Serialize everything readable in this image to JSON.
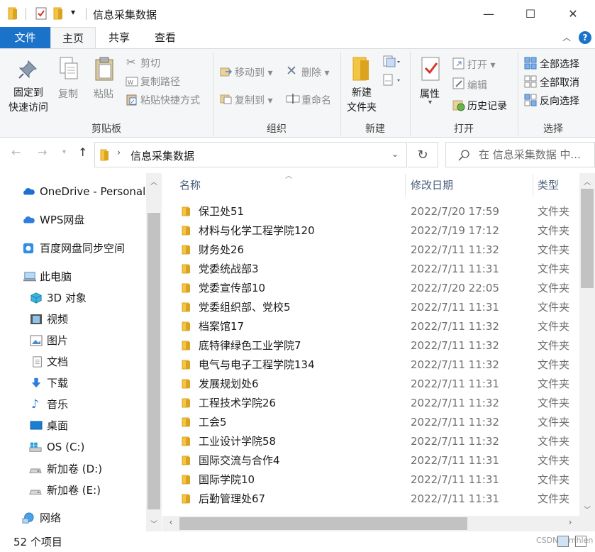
{
  "window": {
    "title": "信息采集数据",
    "quick_access_dropdown": "▾",
    "minimize": "—",
    "maximize": "☐",
    "close": "✕"
  },
  "tabs": [
    {
      "label": "文件"
    },
    {
      "label": "主页"
    },
    {
      "label": "共享"
    },
    {
      "label": "查看"
    }
  ],
  "ribbon": {
    "clipboard": {
      "pin_label_1": "固定到",
      "pin_label_2": "快速访问",
      "copy": "复制",
      "paste": "粘贴",
      "cut": "剪切",
      "copy_path": "复制路径",
      "paste_shortcut": "粘贴快捷方式",
      "group": "剪贴板"
    },
    "organize": {
      "move_to": "移动到",
      "copy_to": "复制到",
      "delete": "删除",
      "rename": "重命名",
      "group": "组织"
    },
    "new": {
      "new_folder_1": "新建",
      "new_folder_2": "文件夹",
      "group": "新建"
    },
    "open": {
      "properties": "属性",
      "open": "打开",
      "edit": "编辑",
      "history": "历史记录",
      "group": "打开"
    },
    "select": {
      "select_all": "全部选择",
      "select_none": "全部取消",
      "invert": "反向选择",
      "group": "选择"
    }
  },
  "address": {
    "path": "信息采集数据",
    "search_placeholder": "在 信息采集数据 中..."
  },
  "nav": [
    {
      "label": "OneDrive - Personal",
      "icon": "cloud-icon"
    },
    {
      "label": "WPS网盘",
      "icon": "cloud-icon"
    },
    {
      "label": "百度网盘同步空间",
      "icon": "baidu-icon"
    },
    {
      "label": "此电脑",
      "icon": "computer-icon"
    },
    {
      "label": "3D 对象",
      "icon": "cube-icon"
    },
    {
      "label": "视频",
      "icon": "film-icon"
    },
    {
      "label": "图片",
      "icon": "picture-icon"
    },
    {
      "label": "文档",
      "icon": "document-icon"
    },
    {
      "label": "下载",
      "icon": "download-icon"
    },
    {
      "label": "音乐",
      "icon": "music-icon"
    },
    {
      "label": "桌面",
      "icon": "desktop-icon"
    },
    {
      "label": "OS (C:)",
      "icon": "windows-drive-icon"
    },
    {
      "label": "新加卷 (D:)",
      "icon": "drive-icon"
    },
    {
      "label": "新加卷 (E:)",
      "icon": "drive-icon"
    },
    {
      "label": "网络",
      "icon": "network-icon"
    }
  ],
  "columns": {
    "name": "名称",
    "date": "修改日期",
    "type": "类型"
  },
  "files": [
    {
      "name": "保卫处51",
      "date": "2022/7/20 17:59",
      "type": "文件夹"
    },
    {
      "name": "材料与化学工程学院120",
      "date": "2022/7/19 17:12",
      "type": "文件夹"
    },
    {
      "name": "财务处26",
      "date": "2022/7/11 11:32",
      "type": "文件夹"
    },
    {
      "name": "党委统战部3",
      "date": "2022/7/11 11:31",
      "type": "文件夹"
    },
    {
      "name": "党委宣传部10",
      "date": "2022/7/20 22:05",
      "type": "文件夹"
    },
    {
      "name": "党委组织部、党校5",
      "date": "2022/7/11 11:31",
      "type": "文件夹"
    },
    {
      "name": "档案馆17",
      "date": "2022/7/11 11:32",
      "type": "文件夹"
    },
    {
      "name": "底特律绿色工业学院7",
      "date": "2022/7/11 11:32",
      "type": "文件夹"
    },
    {
      "name": "电气与电子工程学院134",
      "date": "2022/7/11 11:32",
      "type": "文件夹"
    },
    {
      "name": "发展规划处6",
      "date": "2022/7/11 11:31",
      "type": "文件夹"
    },
    {
      "name": "工程技术学院26",
      "date": "2022/7/11 11:32",
      "type": "文件夹"
    },
    {
      "name": "工会5",
      "date": "2022/7/11 11:32",
      "type": "文件夹"
    },
    {
      "name": "工业设计学院58",
      "date": "2022/7/11 11:32",
      "type": "文件夹"
    },
    {
      "name": "国际交流与合作4",
      "date": "2022/7/11 11:31",
      "type": "文件夹"
    },
    {
      "name": "国际学院10",
      "date": "2022/7/11 11:31",
      "type": "文件夹"
    },
    {
      "name": "后勤管理处67",
      "date": "2022/7/11 11:31",
      "type": "文件夹"
    }
  ],
  "status": {
    "count": "52 个项目",
    "watermark": "CSDN @mhlen"
  },
  "colors": {
    "accent": "#1a73c9",
    "folder": "#f4c542",
    "folder_dark": "#dca321"
  }
}
